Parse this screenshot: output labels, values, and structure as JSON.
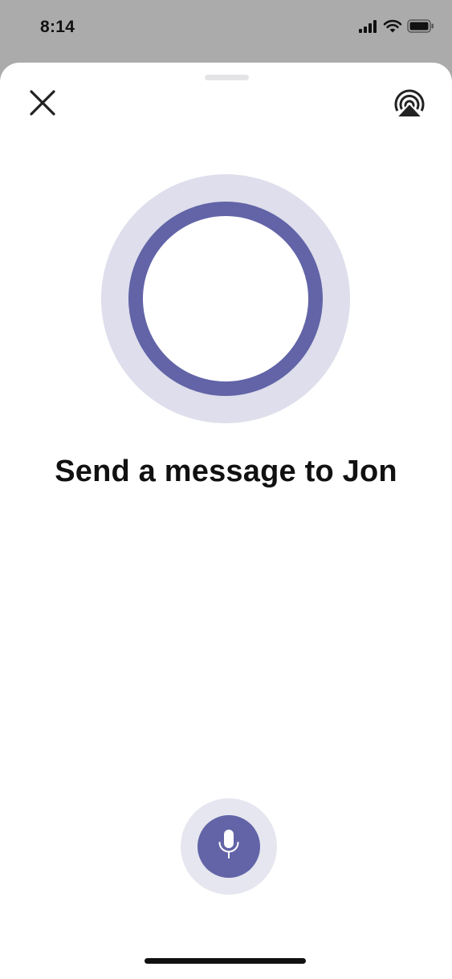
{
  "status_bar": {
    "time": "8:14",
    "icons": [
      "cellular-signal-icon",
      "wifi-icon",
      "battery-icon"
    ]
  },
  "sheet": {
    "close_icon": "close-icon",
    "airplay_icon": "airplay-icon"
  },
  "main": {
    "prompt": "Send a message to Jon"
  },
  "mic": {
    "icon": "microphone-icon"
  },
  "colors": {
    "accent": "#6264a7",
    "accent_light": "#dedeec",
    "mic_halo": "#e6e6f0",
    "status_bar_bg": "#ababab",
    "sheet_bg": "#ffffff",
    "text": "#111111"
  }
}
